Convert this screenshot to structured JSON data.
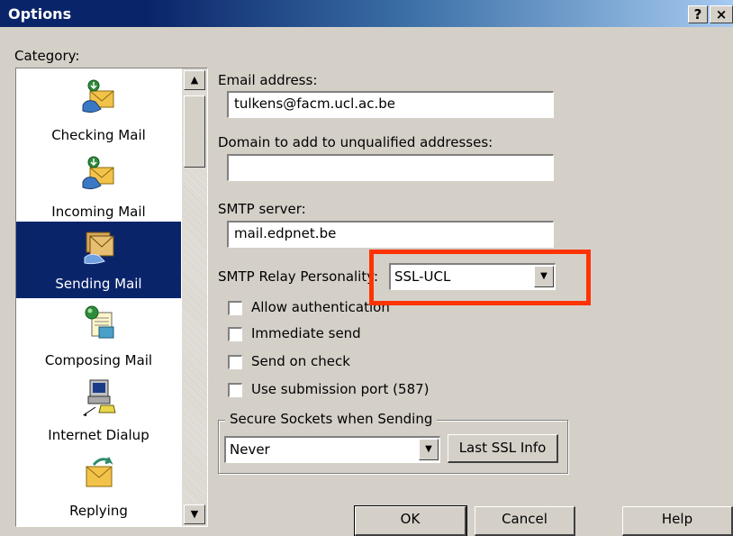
{
  "window": {
    "title": "Options",
    "help_btn": "?",
    "close_btn": "×"
  },
  "category": {
    "label": "Category:",
    "items": [
      {
        "label": "Checking Mail",
        "icon": "envelope-download-icon",
        "selected": false
      },
      {
        "label": "Incoming Mail",
        "icon": "envelope-download-icon",
        "selected": false
      },
      {
        "label": "Sending Mail",
        "icon": "envelope-stack-icon",
        "selected": true
      },
      {
        "label": "Composing Mail",
        "icon": "compose-document-icon",
        "selected": false
      },
      {
        "label": "Internet Dialup",
        "icon": "computer-phone-icon",
        "selected": false
      },
      {
        "label": "Replying",
        "icon": "envelope-reply-icon",
        "selected": false
      }
    ]
  },
  "form": {
    "email_label": "Email address:",
    "email_value": "tulkens@facm.ucl.ac.be",
    "domain_label": "Domain to add to unqualified addresses:",
    "domain_value": "",
    "smtp_label": "SMTP server:",
    "smtp_value": "mail.edpnet.be",
    "relay_label": "SMTP Relay Personality:",
    "relay_value": "SSL-UCL",
    "checkboxes": [
      {
        "label": "Allow authentication",
        "checked": false
      },
      {
        "label": "Immediate send",
        "checked": false
      },
      {
        "label": "Send on check",
        "checked": false
      },
      {
        "label": "Use submission port (587)",
        "checked": false
      }
    ],
    "ssl_group_title": "Secure Sockets when Sending",
    "ssl_value": "Never",
    "last_ssl_btn": "Last SSL Info"
  },
  "buttons": {
    "ok": "OK",
    "cancel": "Cancel",
    "help": "Help"
  },
  "colors": {
    "highlight": "#ff3300",
    "selection": "#0a246a",
    "titlebar": "#0a246a"
  }
}
